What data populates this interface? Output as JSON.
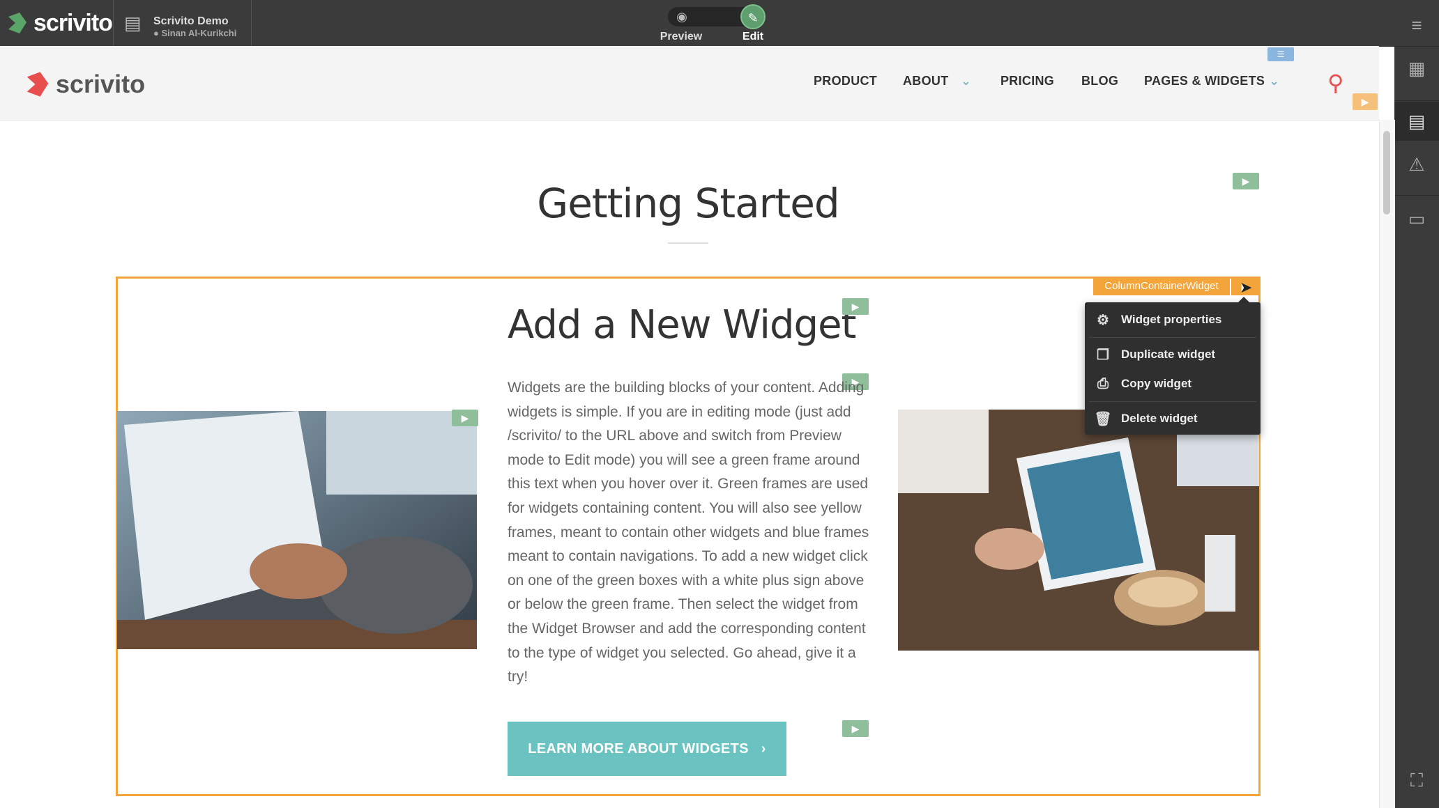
{
  "topbar": {
    "brand": "scrivito",
    "workspace_title": "Scrivito Demo",
    "workspace_user": "Sinan Al-Kurikchi",
    "preview_label": "Preview",
    "edit_label": "Edit",
    "preview_icon": "eye-icon",
    "edit_icon": "pencil-icon"
  },
  "sidebar": {
    "items": [
      {
        "icon": "menu-download-icon"
      },
      {
        "icon": "calendar-icon"
      },
      {
        "icon": "library-icon"
      },
      {
        "icon": "warning-icon"
      },
      {
        "icon": "monitor-icon"
      },
      {
        "icon": "fullscreen-icon"
      }
    ]
  },
  "site": {
    "logo": "scrivito",
    "nav": [
      "PRODUCT",
      "ABOUT",
      "PRICING",
      "BLOG",
      "PAGES & WIDGETS"
    ],
    "search_icon": "search-icon"
  },
  "content": {
    "page_title": "Getting Started",
    "widget_heading": "Add a New Widget",
    "widget_body": "Widgets are the building blocks of your content. Adding widgets is simple. If you are in editing mode (just add /scrivito/ to the URL above and switch from Preview mode to Edit mode) you will see a green frame around this text when you hover over it. Green frames are used for widgets containing content. You will also see yellow frames, meant to contain other widgets and blue frames meant to contain navigations. To add a new widget click on one of the green boxes with a white plus sign above or below the green frame. Then select the widget from the Widget Browser and add the corresponding content to the type of widget you selected. Go ahead, give it a try!",
    "cta_label": "LEARN MORE ABOUT WIDGETS"
  },
  "widget_tag": "ColumnContainerWidget",
  "context_menu": {
    "items": [
      {
        "label": "Widget properties",
        "icon": "gears-icon"
      },
      {
        "label": "Duplicate widget",
        "icon": "duplicate-icon"
      },
      {
        "label": "Copy widget",
        "icon": "clipboard-icon"
      },
      {
        "label": "Delete widget",
        "icon": "trash-icon"
      }
    ]
  },
  "colors": {
    "edit_accent": "#5f9e6e",
    "container_frame": "#f3a43a",
    "cta": "#6ac3c0",
    "brand_red": "#e94e4e"
  }
}
